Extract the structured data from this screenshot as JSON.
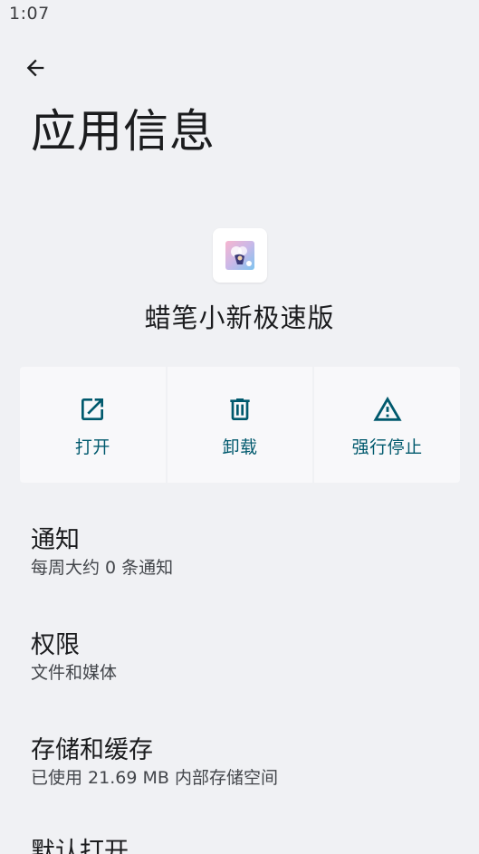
{
  "status_bar": {
    "time": "1:07"
  },
  "header": {
    "back_icon": "arrow-left-icon",
    "title": "应用信息"
  },
  "app": {
    "name": "蜡笔小新极速版",
    "icon": "app-icon"
  },
  "actions": [
    {
      "label": "打开",
      "icon": "open-external-icon"
    },
    {
      "label": "卸载",
      "icon": "trash-icon"
    },
    {
      "label": "强行停止",
      "icon": "warning-triangle-icon"
    }
  ],
  "settings": [
    {
      "title": "通知",
      "summary": "每周大约 0 条通知"
    },
    {
      "title": "权限",
      "summary": "文件和媒体"
    },
    {
      "title": "存储和缓存",
      "summary": "已使用 21.69 MB 内部存储空间"
    },
    {
      "title": "默认打开",
      "summary": ""
    }
  ],
  "colors": {
    "background": "#f0f1f4",
    "accent": "#00596d",
    "card": "#f8f8fa"
  }
}
